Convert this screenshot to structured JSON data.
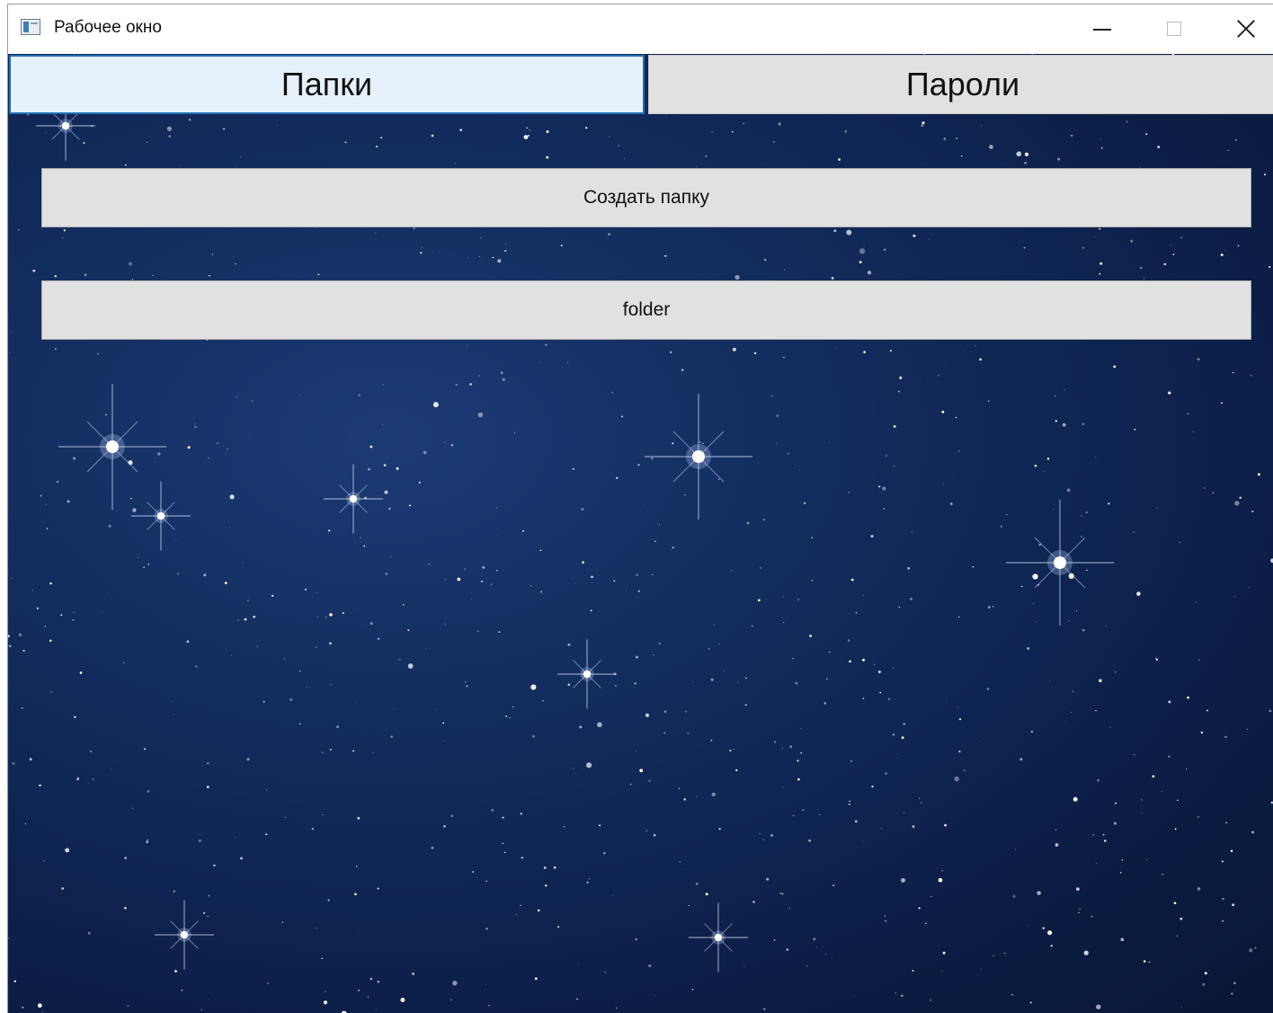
{
  "window": {
    "title": "Рабочее окно",
    "controls": {
      "minimize": "minimize-icon",
      "maximize": "maximize-icon",
      "close": "close-icon"
    }
  },
  "tabs": [
    {
      "label": "Папки",
      "selected": true
    },
    {
      "label": "Пароли",
      "selected": false
    }
  ],
  "main": {
    "create_folder_label": "Создать папку",
    "folders": [
      "folder"
    ]
  },
  "colors": {
    "selected_tab_bg": "#e5f1fb",
    "selected_tab_border": "#1f6fb5",
    "button_bg": "#e1e1e1",
    "background_sky": "#0f2652"
  }
}
